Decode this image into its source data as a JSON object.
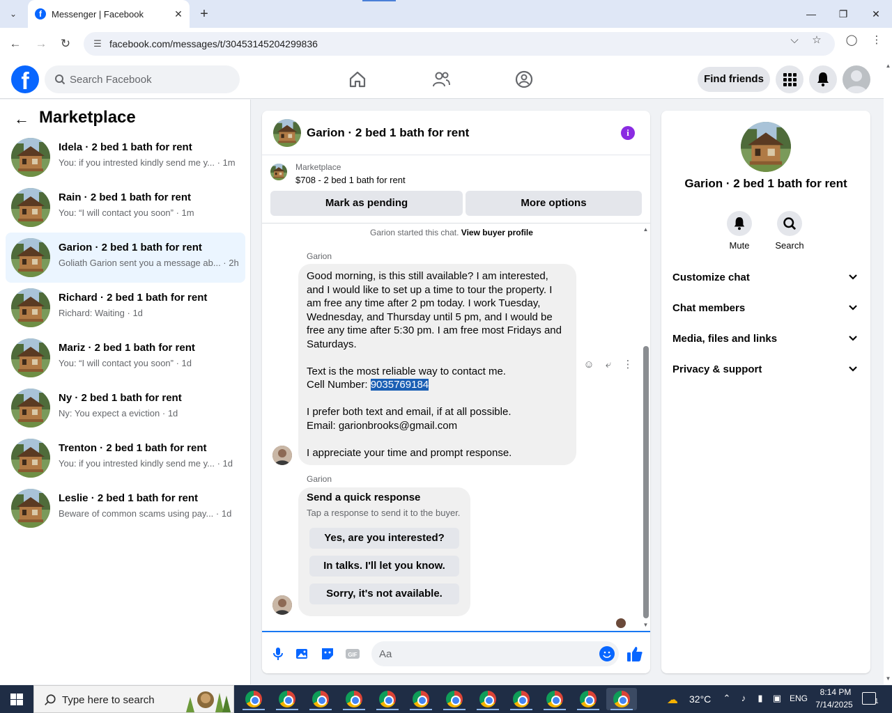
{
  "browser": {
    "tab_title": "Messenger | Facebook",
    "tab_favicon": "f",
    "url": "facebook.com/messages/t/30453145204299836",
    "tab_list_icon": "chevron-down-icon",
    "new_tab_icon": "plus-icon"
  },
  "fb": {
    "logo_letter": "f",
    "search_placeholder": "Search Facebook",
    "find_friends": "Find friends",
    "brand_color": "#0866ff"
  },
  "sidebar": {
    "title": "Marketplace",
    "conversations": [
      {
        "name": "Idela · 2 bed 1 bath for rent",
        "snippet": "You: if you intrested kindly send me y... · 1m"
      },
      {
        "name": "Rain · 2 bed 1 bath for rent",
        "snippet": "You: “I will contact you soon” · 1m"
      },
      {
        "name": "Garion · 2 bed 1 bath for rent",
        "snippet": "Goliath Garion sent you a message ab... · 2h",
        "active": true
      },
      {
        "name": "Richard · 2 bed 1 bath for rent",
        "snippet": "Richard: Waiting · 1d"
      },
      {
        "name": "Mariz · 2 bed 1 bath for rent",
        "snippet": "You: “I will contact you soon” · 1d"
      },
      {
        "name": "Ny · 2 bed 1 bath for rent",
        "snippet": "Ny: You expect a eviction · 1d"
      },
      {
        "name": "Trenton · 2 bed 1 bath for rent",
        "snippet": "You: if you intrested kindly send me y... · 1d"
      },
      {
        "name": "Leslie · 2 bed 1 bath for rent",
        "snippet": "Beware of common scams using pay... · 1d"
      }
    ]
  },
  "chat": {
    "title": "Garion · 2 bed 1 bath for rent",
    "info_glyph": "i",
    "listing_category": "Marketplace",
    "listing_price": "$708 - 2 bed 1 bath for rent",
    "mark_pending": "Mark as pending",
    "more_options": "More options",
    "started_text": "Garion started this chat.",
    "view_profile": "View buyer profile",
    "sender_name": "Garion",
    "message": {
      "p1": "Good morning, is this still available? I am interested, and I would like to set up a time to tour the property. I am free any time after 2 pm today. I work Tuesday, Wednesday, and Thursday until 5 pm, and I would be free any time after 5:30 pm. I am free most Fridays and Saturdays.",
      "p2_line1": "Text is the most reliable way to contact me.",
      "p2_prefix": "Cell Number: ",
      "cell_number": "9035769184",
      "p3_line1": "I prefer both text and email, if at all possible.",
      "p3_line2": "Email: garionbrooks@gmail.com",
      "p4": "I appreciate your time and prompt response."
    },
    "quick": {
      "title": "Send a quick response",
      "subtitle": "Tap a response to send it to the buyer.",
      "options": [
        "Yes, are you interested?",
        "In talks. I'll let you know.",
        "Sorry, it's not available."
      ]
    },
    "composer_placeholder": "Aa"
  },
  "right": {
    "title": "Garion · 2 bed 1 bath for rent",
    "mute": "Mute",
    "search": "Search",
    "sections": [
      "Customize chat",
      "Chat members",
      "Media, files and links",
      "Privacy & support"
    ]
  },
  "taskbar": {
    "search_placeholder": "Type here to search",
    "weather": "32°C",
    "lang": "ENG",
    "time": "8:14 PM",
    "date": "7/14/2025",
    "notif_count": "1"
  }
}
